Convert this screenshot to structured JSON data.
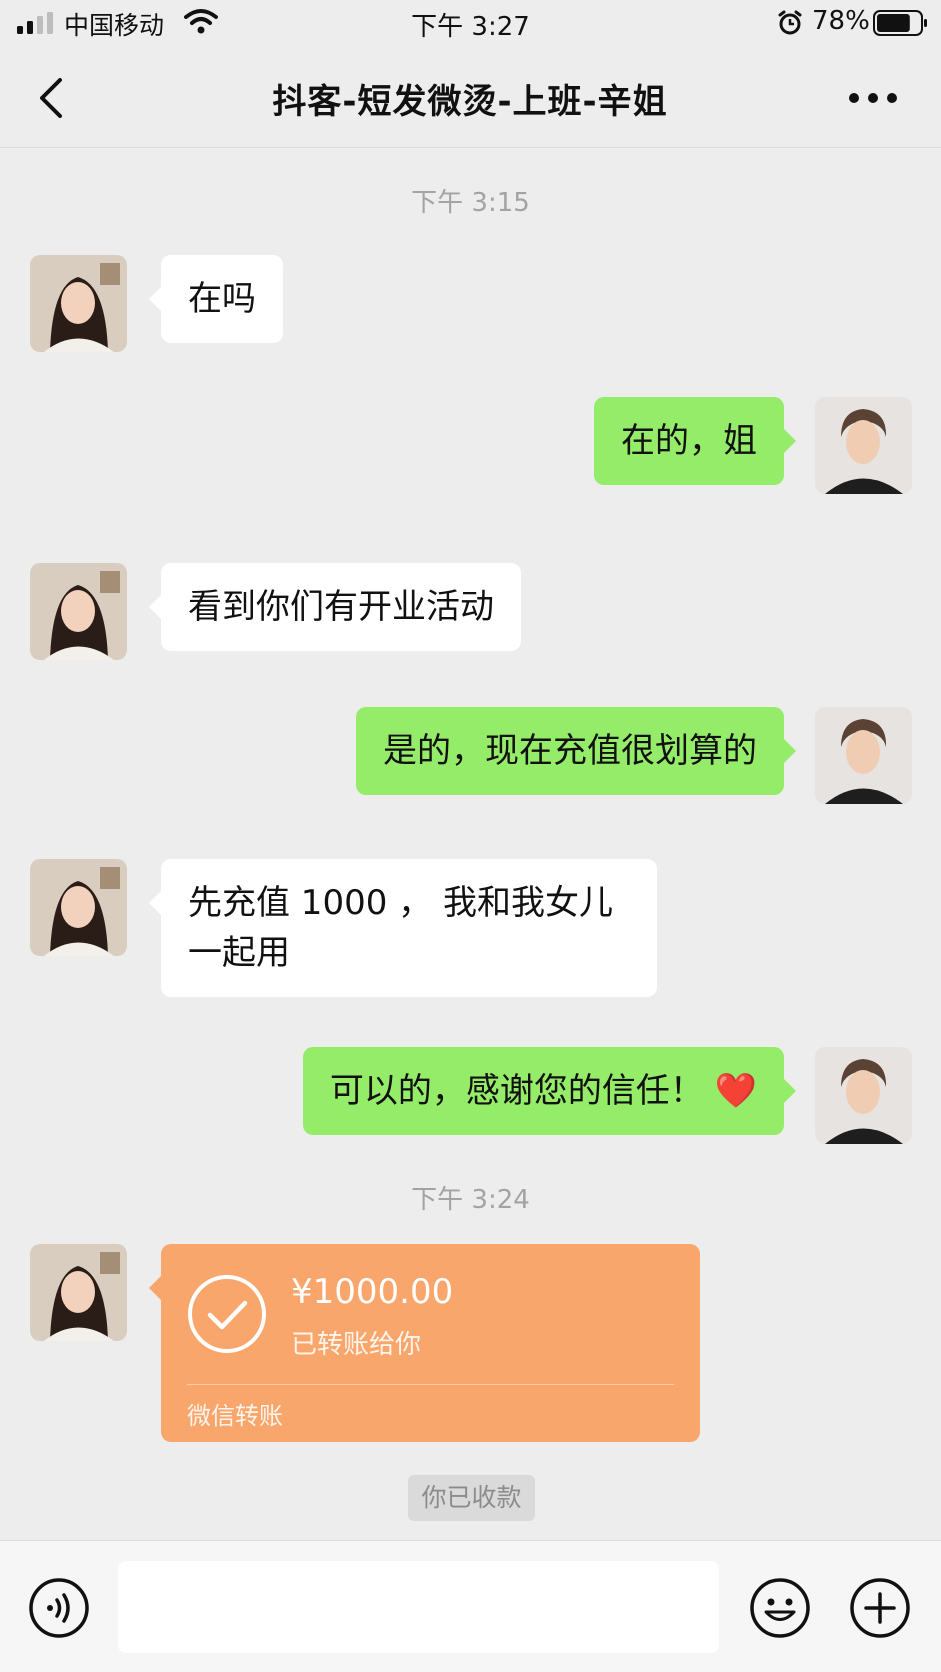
{
  "status_bar": {
    "carrier": "中国移动",
    "time": "下午 3:27",
    "battery_percent": "78%",
    "battery_level": 0.78,
    "icons": [
      "signal-icon",
      "wifi-icon",
      "alarm-icon",
      "battery-icon"
    ]
  },
  "nav": {
    "title": "抖客-短发微烫-上班-辛姐",
    "icons": [
      "back-icon",
      "more-icon"
    ]
  },
  "chat": {
    "timestamp_1": "下午 3:15",
    "messages": [
      {
        "from": "contact",
        "text": "在吗"
      },
      {
        "from": "me",
        "text": "在的，姐"
      },
      {
        "from": "contact",
        "text": "看到你们有开业活动"
      },
      {
        "from": "me",
        "text": "是的，现在充值很划算的"
      },
      {
        "from": "contact",
        "line1": "先充值 1000 ， 我和我女儿",
        "line2": "一起用"
      },
      {
        "from": "me",
        "text": "可以的，感谢您的信任！",
        "emoji": "❤️"
      }
    ],
    "timestamp_2": "下午 3:24",
    "transfer": {
      "amount": "¥1000.00",
      "status": "已转账给你",
      "label": "微信转账",
      "icon": "check-circle-icon"
    },
    "received_notice": "你已收款"
  },
  "input_bar": {
    "placeholder": "",
    "icons": [
      "voice-icon",
      "emoji-icon",
      "plus-icon"
    ]
  },
  "colors": {
    "background": "#ededed",
    "incoming_bubble": "#ffffff",
    "outgoing_bubble": "#95ec69",
    "transfer_card": "#f9a66d",
    "timestamp": "#a3a3a3"
  }
}
